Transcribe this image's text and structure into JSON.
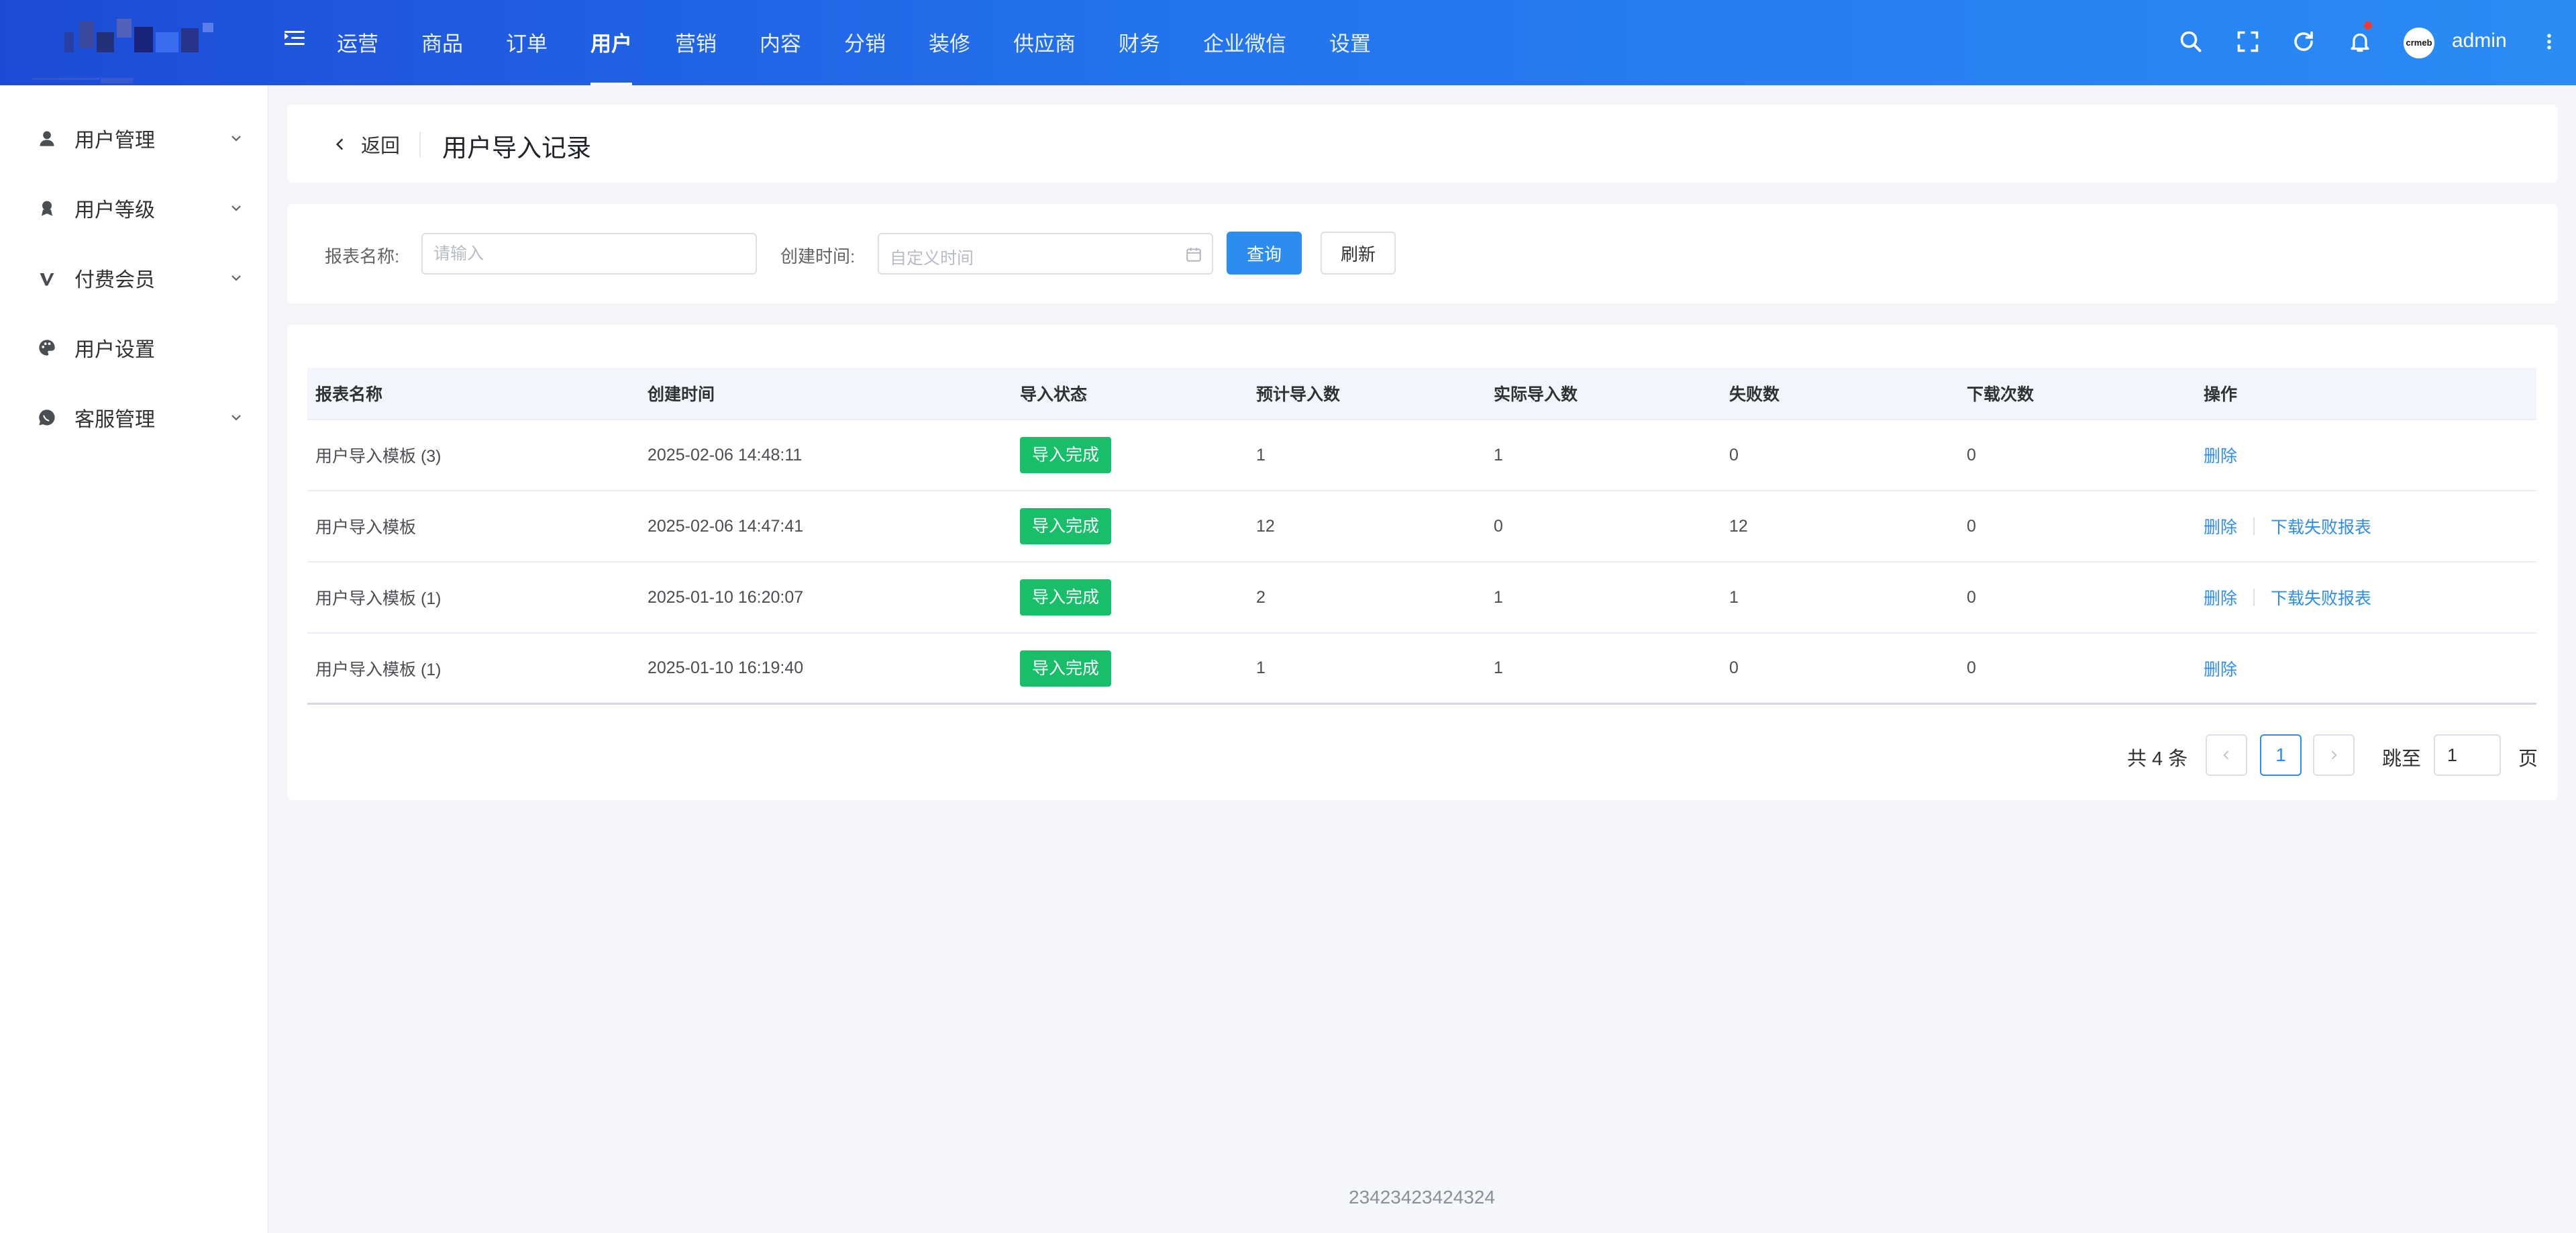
{
  "header": {
    "nav": [
      {
        "label": "运营",
        "active": false
      },
      {
        "label": "商品",
        "active": false
      },
      {
        "label": "订单",
        "active": false
      },
      {
        "label": "用户",
        "active": true
      },
      {
        "label": "营销",
        "active": false
      },
      {
        "label": "内容",
        "active": false
      },
      {
        "label": "分销",
        "active": false
      },
      {
        "label": "装修",
        "active": false
      },
      {
        "label": "供应商",
        "active": false
      },
      {
        "label": "财务",
        "active": false
      },
      {
        "label": "企业微信",
        "active": false
      },
      {
        "label": "设置",
        "active": false
      }
    ],
    "user_name": "admin",
    "avatar_text": "crmeb",
    "accent": "#2373ee"
  },
  "sidebar": {
    "items": [
      {
        "label": "用户管理",
        "icon": "user-icon",
        "expandable": true
      },
      {
        "label": "用户等级",
        "icon": "level-badge-icon",
        "expandable": true
      },
      {
        "label": "付费会员",
        "icon": "vip-icon",
        "expandable": true
      },
      {
        "label": "用户设置",
        "icon": "palette-icon",
        "expandable": false
      },
      {
        "label": "客服管理",
        "icon": "chat-icon",
        "expandable": true
      }
    ]
  },
  "page": {
    "back_label": "返回",
    "title": "用户导入记录"
  },
  "filters": {
    "name_label": "报表名称:",
    "name_placeholder": "请输入",
    "time_label": "创建时间:",
    "time_placeholder": "自定义时间",
    "query_label": "查询",
    "refresh_label": "刷新"
  },
  "table": {
    "headers": [
      "报表名称",
      "创建时间",
      "导入状态",
      "预计导入数",
      "实际导入数",
      "失败数",
      "下载次数",
      "操作"
    ],
    "rows": [
      {
        "name": "用户导入模板 (3)",
        "created": "2025-02-06 14:48:11",
        "status": "导入完成",
        "expected": "1",
        "actual": "1",
        "failed": "0",
        "downloads": "0",
        "ops": [
          "删除"
        ]
      },
      {
        "name": "用户导入模板",
        "created": "2025-02-06 14:47:41",
        "status": "导入完成",
        "expected": "12",
        "actual": "0",
        "failed": "12",
        "downloads": "0",
        "ops": [
          "删除",
          "下载失败报表"
        ]
      },
      {
        "name": "用户导入模板 (1)",
        "created": "2025-01-10 16:20:07",
        "status": "导入完成",
        "expected": "2",
        "actual": "1",
        "failed": "1",
        "downloads": "0",
        "ops": [
          "删除",
          "下载失败报表"
        ]
      },
      {
        "name": "用户导入模板 (1)",
        "created": "2025-01-10 16:19:40",
        "status": "导入完成",
        "expected": "1",
        "actual": "1",
        "failed": "0",
        "downloads": "0",
        "ops": [
          "删除"
        ]
      }
    ],
    "status_color": "#19be6b",
    "link_color": "#2d8cf0"
  },
  "pagination": {
    "total_text": "共 4 条",
    "current_page": "1",
    "jump_label": "跳至",
    "jump_value": "1",
    "page_suffix": "页"
  },
  "footer": {
    "text": "23423423424324"
  }
}
